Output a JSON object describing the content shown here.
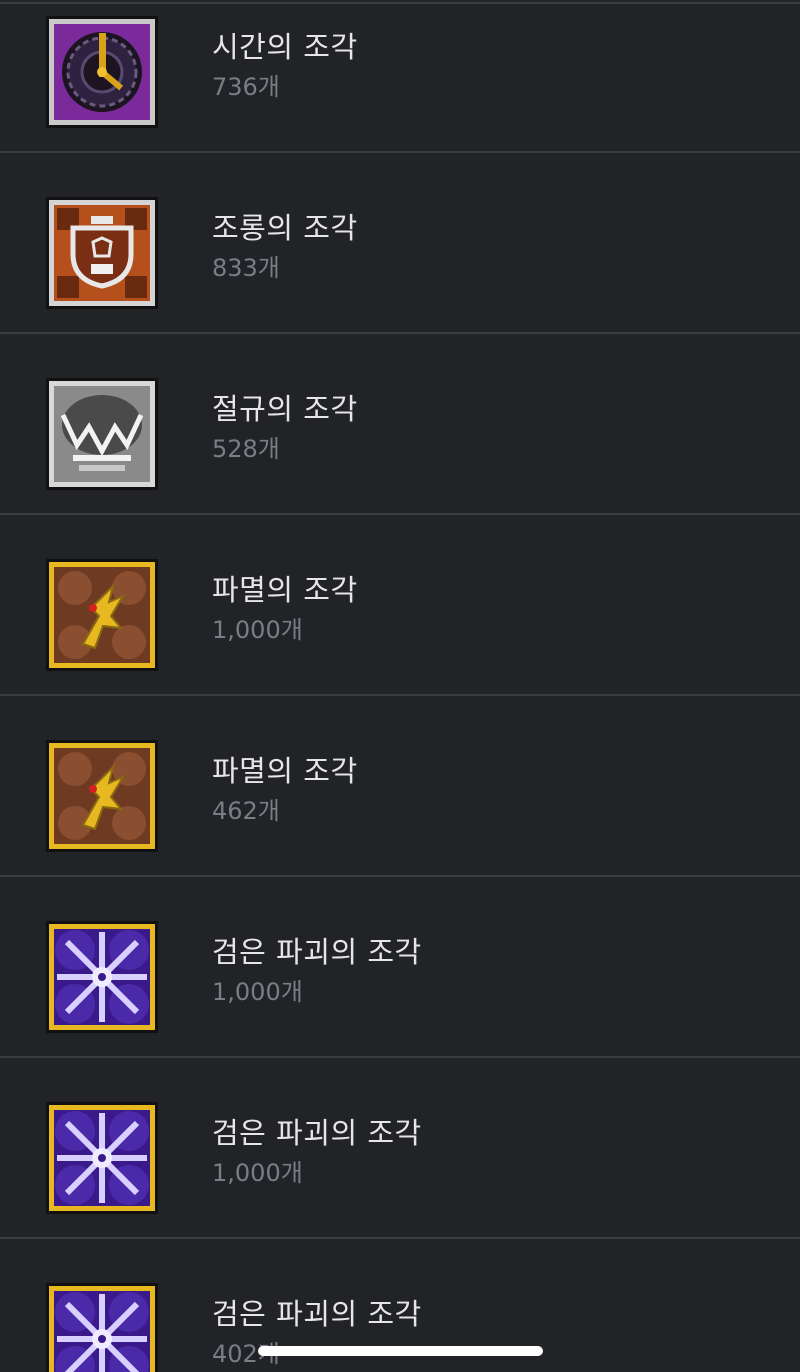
{
  "items": [
    {
      "name": "시간의 조각",
      "count": "736개",
      "icon": "time-fragment-icon"
    },
    {
      "name": "조롱의 조각",
      "count": "833개",
      "icon": "mockery-fragment-icon"
    },
    {
      "name": "절규의 조각",
      "count": "528개",
      "icon": "scream-fragment-icon"
    },
    {
      "name": "파멸의 조각",
      "count": "1,000개",
      "icon": "ruin-fragment-icon"
    },
    {
      "name": "파멸의 조각",
      "count": "462개",
      "icon": "ruin-fragment-icon"
    },
    {
      "name": "검은 파괴의 조각",
      "count": "1,000개",
      "icon": "black-destruction-fragment-icon"
    },
    {
      "name": "검은 파괴의 조각",
      "count": "1,000개",
      "icon": "black-destruction-fragment-icon"
    },
    {
      "name": "검은 파괴의 조각",
      "count": "402개",
      "icon": "black-destruction-fragment-icon"
    }
  ],
  "colors": {
    "background": "#222327",
    "divider": "#3a3c44",
    "name_text": "#e6e6e8",
    "count_text": "#7b7d86",
    "time_purple": "#7a2a9a",
    "mockery_orange": "#b5501c",
    "scream_gray": "#8a8a8a",
    "ruin_brown": "#6e3a22",
    "ruin_gold": "#e8b820",
    "destruction_violet": "#3a1a8a"
  }
}
